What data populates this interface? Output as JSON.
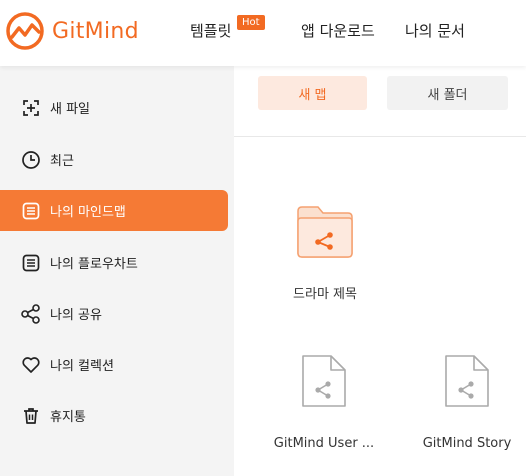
{
  "header": {
    "logo_text": "GitMind",
    "nav": [
      {
        "label": "템플릿",
        "badge": "Hot"
      },
      {
        "label": "앱 다운로드"
      },
      {
        "label": "나의 문서"
      }
    ]
  },
  "sidebar": {
    "items": [
      {
        "label": "새 파일",
        "icon": "add-file-icon"
      },
      {
        "label": "최근",
        "icon": "clock-icon"
      },
      {
        "label": "나의 마인드맵",
        "icon": "list-icon",
        "active": true
      },
      {
        "label": "나의 플로우차트",
        "icon": "list-icon"
      },
      {
        "label": "나의 공유",
        "icon": "share-icon"
      },
      {
        "label": "나의 컬렉션",
        "icon": "heart-icon"
      },
      {
        "label": "휴지통",
        "icon": "trash-icon"
      }
    ]
  },
  "toolbar": {
    "new_map_label": "새 맵",
    "new_folder_label": "새 폴더"
  },
  "files": [
    {
      "name": "드라마 제목",
      "type": "folder"
    },
    {
      "name": "GitMind User ...",
      "type": "mindmap"
    },
    {
      "name": "GitMind Story",
      "type": "mindmap"
    }
  ],
  "colors": {
    "accent": "#f26a22",
    "active_bg": "#f57a35",
    "sidebar_bg": "#f4f4f4"
  }
}
